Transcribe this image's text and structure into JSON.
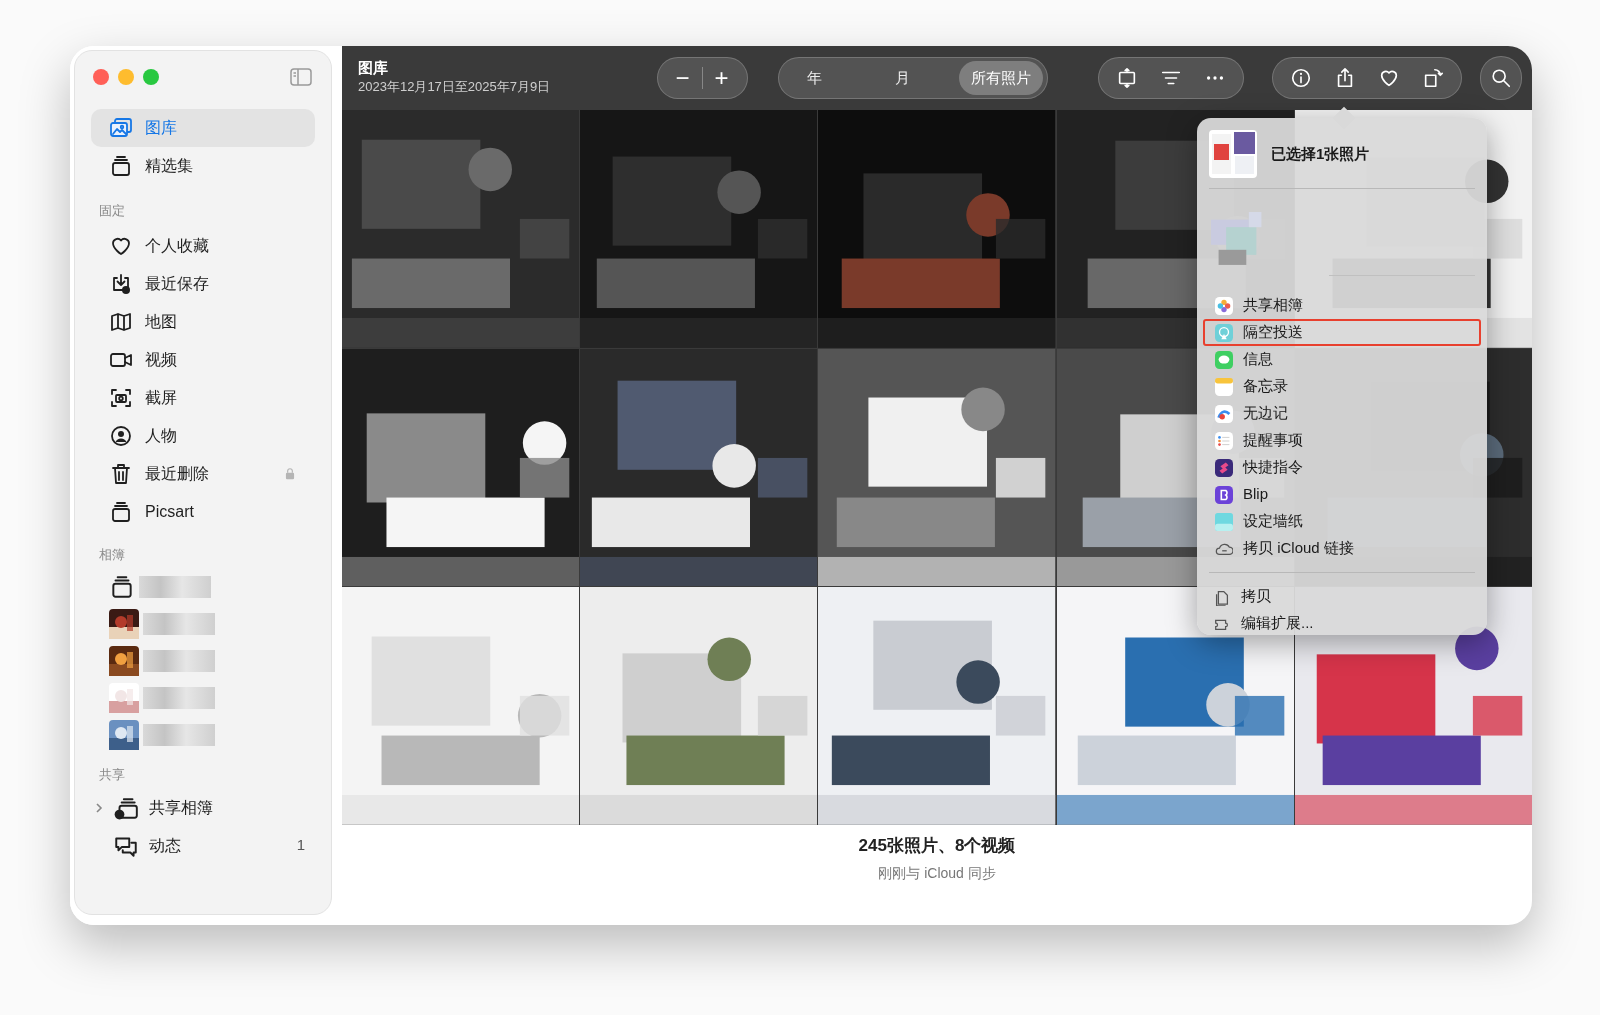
{
  "window": {
    "title": "图库",
    "subtitle": "2023年12月17日至2025年7月9日"
  },
  "sidebar": {
    "top_items": [
      {
        "label": "图库",
        "selected": true
      },
      {
        "label": "精选集",
        "selected": false
      }
    ],
    "pinned": {
      "heading": "固定",
      "items": [
        {
          "label": "个人收藏",
          "selected": false,
          "locked": false
        },
        {
          "label": "最近保存",
          "selected": false,
          "locked": false
        },
        {
          "label": "地图",
          "selected": false,
          "locked": false
        },
        {
          "label": "视频",
          "selected": false,
          "locked": false
        },
        {
          "label": "截屏",
          "selected": false,
          "locked": false
        },
        {
          "label": "人物",
          "selected": false,
          "locked": false
        },
        {
          "label": "最近删除",
          "selected": false,
          "locked": true
        },
        {
          "label": "Picsart",
          "selected": false,
          "locked": false
        }
      ]
    },
    "albums": {
      "heading": "相簿",
      "items": [
        {
          "kind": "stack"
        },
        {
          "kind": "picture"
        },
        {
          "kind": "picture"
        },
        {
          "kind": "picture"
        },
        {
          "kind": "picture"
        }
      ]
    },
    "shared": {
      "heading": "共享",
      "items": [
        {
          "label": "共享相簿",
          "expanded": false
        },
        {
          "label": "动态",
          "count": "1"
        }
      ]
    }
  },
  "toolbar": {
    "zoom_out": "−",
    "zoom_in": "+",
    "views": [
      {
        "label": "年",
        "selected": false
      },
      {
        "label": "月",
        "selected": false
      },
      {
        "label": "所有照片",
        "selected": true
      }
    ]
  },
  "share_menu": {
    "header": "已选择1张照片",
    "apps": [
      {
        "label": "共享相簿",
        "highlighted": false
      },
      {
        "label": "隔空投送",
        "highlighted": true
      },
      {
        "label": "信息",
        "highlighted": false
      },
      {
        "label": "备忘录",
        "highlighted": false
      },
      {
        "label": "无边记",
        "highlighted": false
      },
      {
        "label": "提醒事项",
        "highlighted": false
      },
      {
        "label": "快捷指令",
        "highlighted": false
      },
      {
        "label": "Blip",
        "highlighted": false
      },
      {
        "label": "设定墙纸",
        "highlighted": false
      },
      {
        "label": "拷贝 iCloud 链接",
        "highlighted": false
      }
    ],
    "actions": [
      {
        "label": "拷贝"
      },
      {
        "label": "编辑扩展..."
      }
    ]
  },
  "footer": {
    "summary": "245张照片、8个视频",
    "sync_status": "刚刚与 iCloud 同步"
  }
}
